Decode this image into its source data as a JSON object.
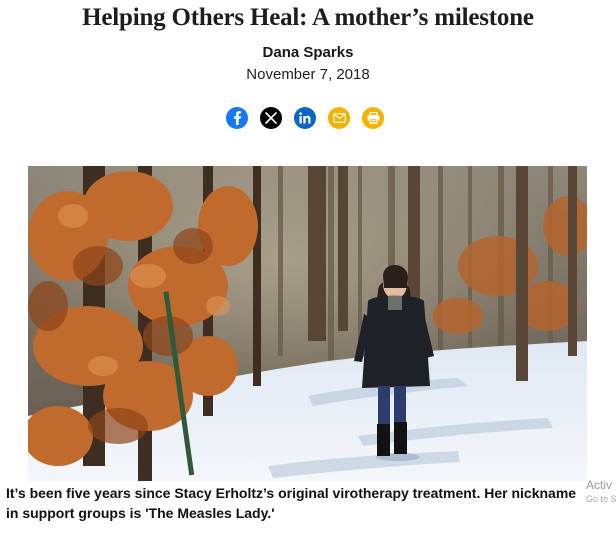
{
  "article": {
    "title": "Helping Others Heal: A mother’s milestone",
    "author": "Dana Sparks",
    "date": "November 7, 2018"
  },
  "share_buttons": [
    {
      "icon": "facebook-icon",
      "color": "#1877f2"
    },
    {
      "icon": "x-icon",
      "color": "#000000"
    },
    {
      "icon": "linkedin-icon",
      "color": "#0a66c2"
    },
    {
      "icon": "email-icon",
      "color": "#f2b300"
    },
    {
      "icon": "print-icon",
      "color": "#f2b300"
    }
  ],
  "photo": {
    "subject": "woman in dark coat walking on snowy forest trail"
  },
  "caption": {
    "line1": "It’s been five years since Stacy Erholtz’s original virotherapy treatment. Her nickname",
    "line2": "in support groups is 'The Measles Lady.'"
  },
  "os_overlay": {
    "watermark_line1": "Activ",
    "watermark_line2": "Go to S"
  }
}
